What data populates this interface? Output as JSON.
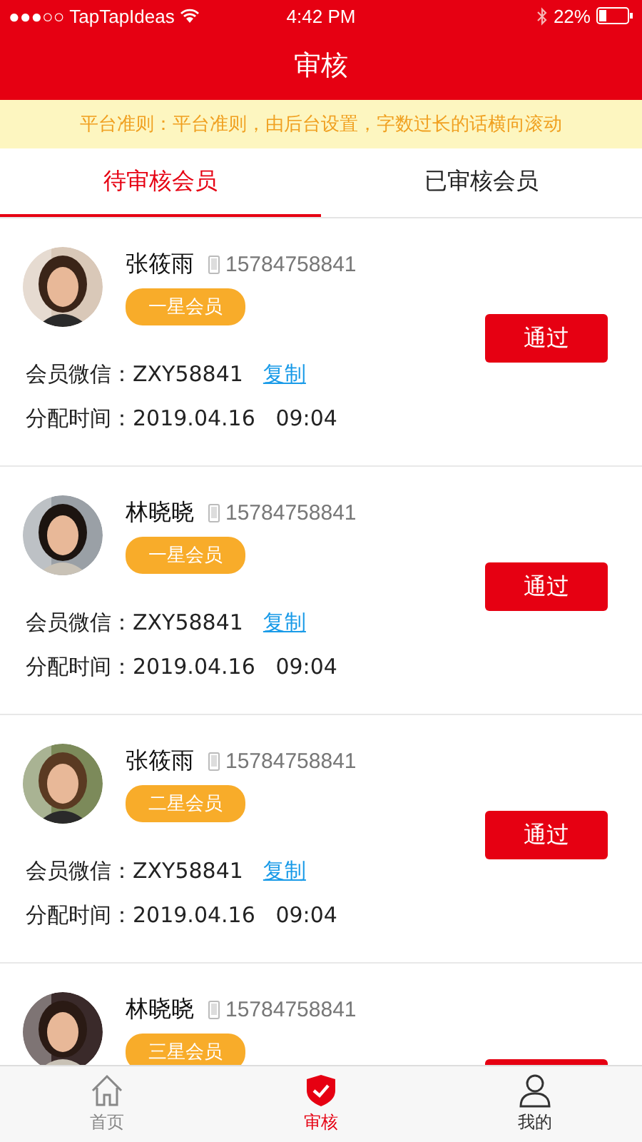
{
  "status_bar": {
    "carrier": "●●●○○ TapTapIdeas",
    "time": "4:42 PM",
    "battery": "22%"
  },
  "header": {
    "title": "审核"
  },
  "notice": "平台准则：平台准则，由后台设置，字数过长的话横向滚动",
  "tabs": [
    {
      "label": "待审核会员",
      "selected": true
    },
    {
      "label": "已审核会员",
      "selected": false
    }
  ],
  "members": [
    {
      "name": "张筱雨",
      "phone": "15784758841",
      "level": "一星会员",
      "wechat_label": "会员微信：",
      "wechat": "ZXY58841",
      "copy": "复制",
      "time_label": "分配时间：",
      "time": "2019.04.16   09:04",
      "button": "通过"
    },
    {
      "name": "林晓晓",
      "phone": "15784758841",
      "level": "一星会员",
      "wechat_label": "会员微信：",
      "wechat": "ZXY58841",
      "copy": "复制",
      "time_label": "分配时间：",
      "time": "2019.04.16   09:04",
      "button": "通过"
    },
    {
      "name": "张筱雨",
      "phone": "15784758841",
      "level": "二星会员",
      "wechat_label": "会员微信：",
      "wechat": "ZXY58841",
      "copy": "复制",
      "time_label": "分配时间：",
      "time": "2019.04.16   09:04",
      "button": "通过"
    },
    {
      "name": "林晓晓",
      "phone": "15784758841",
      "level": "三星会员"
    }
  ],
  "nav": [
    {
      "label": "首页",
      "kind": "home",
      "selected": false
    },
    {
      "label": "审核",
      "kind": "review",
      "selected": true
    },
    {
      "label": "我的",
      "kind": "profile",
      "selected": false
    }
  ]
}
